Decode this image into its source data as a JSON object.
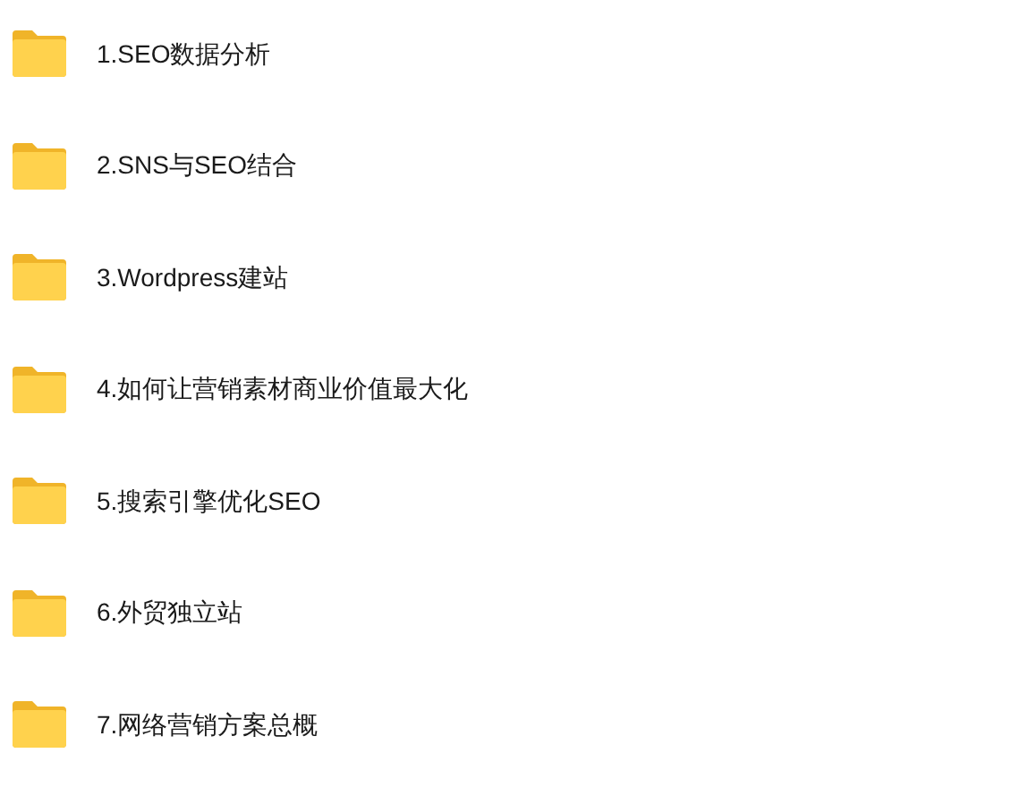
{
  "folders": [
    {
      "name": "1.SEO数据分析"
    },
    {
      "name": "2.SNS与SEO结合"
    },
    {
      "name": "3.Wordpress建站"
    },
    {
      "name": "4.如何让营销素材商业价值最大化"
    },
    {
      "name": "5.搜索引擎优化SEO"
    },
    {
      "name": "6.外贸独立站"
    },
    {
      "name": "7.网络营销方案总概"
    }
  ]
}
